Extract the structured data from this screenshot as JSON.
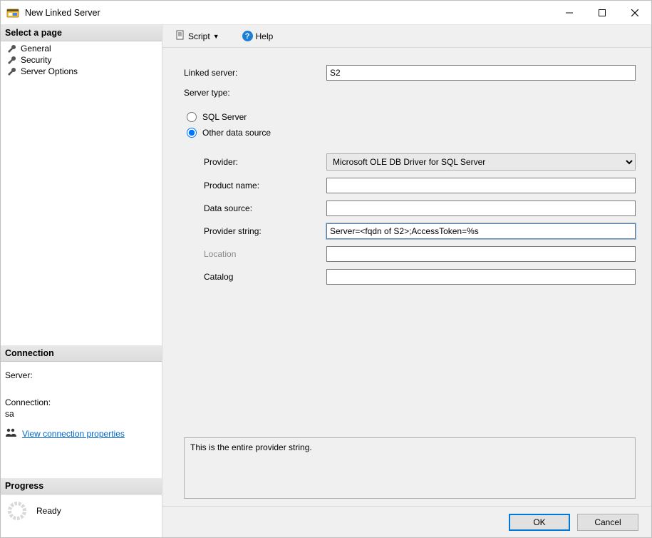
{
  "window": {
    "title": "New Linked Server"
  },
  "sidebar": {
    "header": "Select a page",
    "items": [
      {
        "label": "General"
      },
      {
        "label": "Security"
      },
      {
        "label": "Server Options"
      }
    ]
  },
  "connection": {
    "header": "Connection",
    "server_label": "Server:",
    "server_value": "",
    "connection_label": "Connection:",
    "connection_value": "sa",
    "view_properties": "View connection properties"
  },
  "progress": {
    "header": "Progress",
    "status": "Ready"
  },
  "toolbar": {
    "script_label": "Script",
    "help_label": "Help"
  },
  "form": {
    "linked_server_label": "Linked server:",
    "linked_server_value": "S2",
    "server_type_label": "Server type:",
    "radio_sqlserver": "SQL Server",
    "radio_other": "Other data source",
    "provider_label": "Provider:",
    "provider_selected": "Microsoft OLE DB Driver for SQL Server",
    "product_name_label": "Product name:",
    "product_name_value": "",
    "data_source_label": "Data source:",
    "data_source_value": "",
    "provider_string_label": "Provider string:",
    "provider_string_value": "Server=<fqdn of S2>;AccessToken=%s",
    "location_label": "Location",
    "location_value": "",
    "catalog_label": "Catalog",
    "catalog_value": ""
  },
  "message": "This is the entire provider string.",
  "footer": {
    "ok": "OK",
    "cancel": "Cancel"
  }
}
